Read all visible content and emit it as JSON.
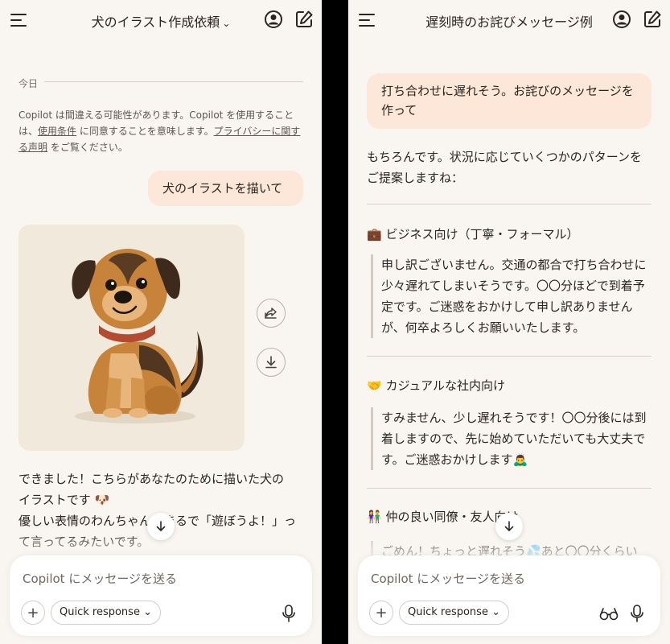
{
  "left": {
    "title": "犬のイラスト作成依頼",
    "date_label": "今日",
    "disclaimer": {
      "part1": "Copilot は間違える可能性があります。Copilot を使用することは、",
      "terms_link": "使用条件",
      "part2": " に同意することを意味します。",
      "privacy_link": "プライバシーに関する声明",
      "part3": " をご覧ください。"
    },
    "user_message": "犬のイラストを描いて",
    "reply_lines": [
      "できました！こちらがあなたのために描いた犬の",
      "イラストです 🐶",
      "優しい表情のわんちゃん、まるで「遊ぼうよ！」っ",
      "て言ってるみたいです。"
    ]
  },
  "right": {
    "title": "遅刻時のお詫びメッセージ例",
    "user_message": "打ち合わせに遅れそう。お詫びのメッセージを作って",
    "reply_intro": "もちろんです。状況に応じていくつかのパターンをご提案しますね：",
    "sections": [
      {
        "heading": "💼 ビジネス向け（丁寧・フォーマル）",
        "quote": "申し訳ございません。交通の都合で打ち合わせに少々遅れてしまいそうです。〇〇分ほどで到着予定です。ご迷惑をおかけして申し訳ありませんが、何卒よろしくお願いいたします。"
      },
      {
        "heading": "🤝 カジュアルな社内向け",
        "quote": "すみません、少し遅れそうです！〇〇分後には到着しますので、先に始めていただいても大丈夫です。ご迷惑おかけします🙇‍♂️"
      },
      {
        "heading": "👫 仲の良い同僚・友人向け",
        "quote": "ごめん！ちょっと遅れそう💦あと〇〇分くらい"
      }
    ]
  },
  "composer": {
    "placeholder": "Copilot にメッセージを送る",
    "quick_response": "Quick response"
  },
  "icons": {
    "menu": "menu-icon",
    "account": "account-icon",
    "new_chat": "new-chat-icon",
    "share": "share-icon",
    "download": "download-icon",
    "scroll_down": "arrow-down-icon",
    "plus": "plus-icon",
    "microphone": "microphone-icon",
    "vision": "glasses-icon"
  },
  "colors": {
    "background": "#f9f5f0",
    "user_bubble": "#fce7d8",
    "divider": "#d9d1c9"
  }
}
